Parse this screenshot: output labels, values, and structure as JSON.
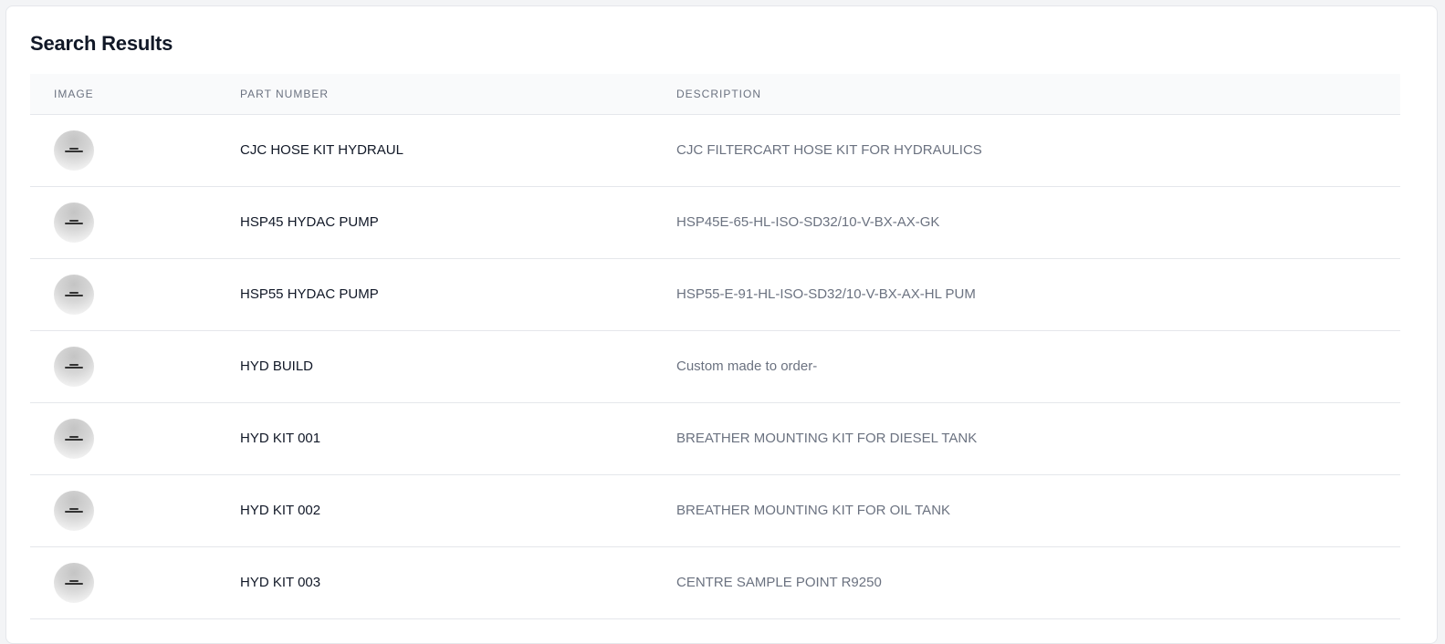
{
  "title": "Search Results",
  "columns": {
    "image": "IMAGE",
    "part_number": "PART NUMBER",
    "description": "DESCRIPTION"
  },
  "thumbnail_icon": "image-not-available-icon",
  "rows": [
    {
      "part_number": "CJC HOSE KIT HYDRAUL",
      "description": "CJC FILTERCART HOSE KIT FOR HYDRAULICS"
    },
    {
      "part_number": "HSP45 HYDAC PUMP",
      "description": "HSP45E-65-HL-ISO-SD32/10-V-BX-AX-GK"
    },
    {
      "part_number": "HSP55 HYDAC PUMP",
      "description": "HSP55-E-91-HL-ISO-SD32/10-V-BX-AX-HL PUM"
    },
    {
      "part_number": "HYD BUILD",
      "description": "Custom made to order-"
    },
    {
      "part_number": "HYD KIT 001",
      "description": "BREATHER MOUNTING KIT FOR DIESEL TANK"
    },
    {
      "part_number": "HYD KIT 002",
      "description": "BREATHER MOUNTING KIT FOR OIL TANK"
    },
    {
      "part_number": "HYD KIT 003",
      "description": "CENTRE SAMPLE POINT R9250"
    }
  ]
}
